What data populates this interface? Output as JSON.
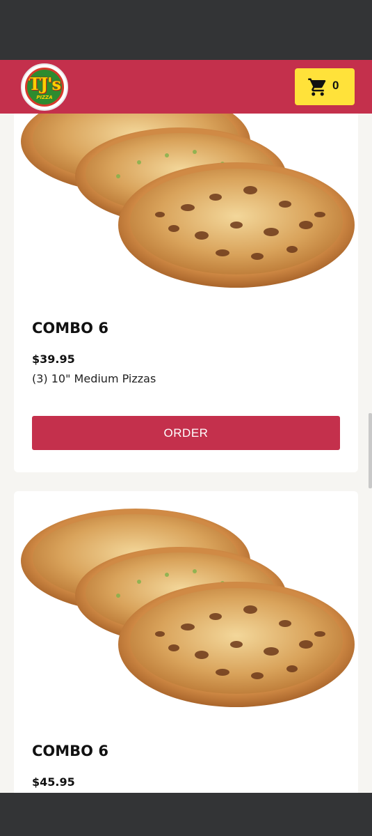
{
  "header": {
    "logo_text": "TJ's",
    "logo_sub": "PIZZA",
    "cart_count": "0"
  },
  "products": [
    {
      "title": "COMBO 6",
      "price": "$39.95",
      "description": "(3) 10\" Medium Pizzas",
      "order_label": "ORDER"
    },
    {
      "title": "COMBO 6",
      "price": "$45.95"
    }
  ],
  "colors": {
    "brand_red": "#c4304c",
    "cart_yellow": "#ffe23a",
    "system_bar": "#333436",
    "page_bg": "#f6f5f2"
  },
  "icons": {
    "cart": "shopping-cart-icon"
  }
}
